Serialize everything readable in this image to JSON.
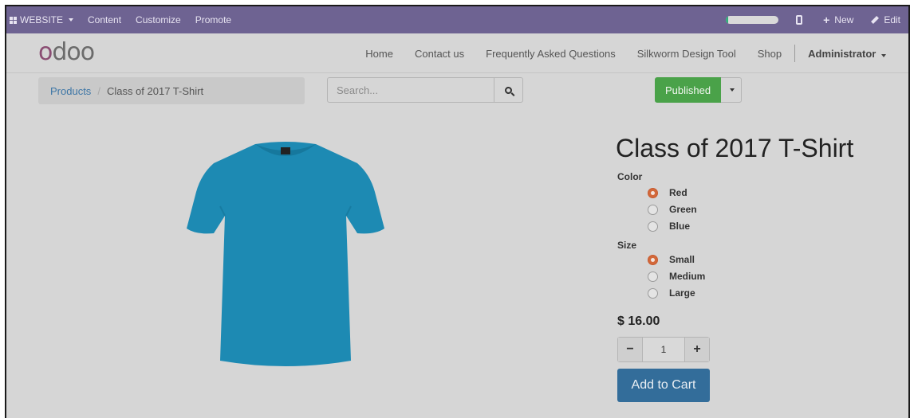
{
  "adminbar": {
    "website_label": "WEBSITE",
    "content_label": "Content",
    "customize_label": "Customize",
    "promote_label": "Promote",
    "new_label": "New",
    "edit_label": "Edit",
    "progress_fraction": 0.05
  },
  "navbar": {
    "logo": "odoo",
    "links": [
      "Home",
      "Contact us",
      "Frequently Asked Questions",
      "Silkworm Design Tool",
      "Shop"
    ],
    "user": "Administrator"
  },
  "breadcrumb": {
    "parent": "Products",
    "current": "Class of 2017 T-Shirt"
  },
  "search": {
    "placeholder": "Search..."
  },
  "publish": {
    "label": "Published",
    "color": "#4aa249"
  },
  "product": {
    "title": "Class of 2017 T-Shirt",
    "shirt_color": "#1d8ab3",
    "color_label": "Color",
    "colors": [
      "Red",
      "Green",
      "Blue"
    ],
    "selected_color": "Red",
    "size_label": "Size",
    "sizes": [
      "Small",
      "Medium",
      "Large"
    ],
    "selected_size": "Small",
    "price": "$ 16.00",
    "quantity": "1",
    "add_to_cart": "Add to Cart"
  }
}
